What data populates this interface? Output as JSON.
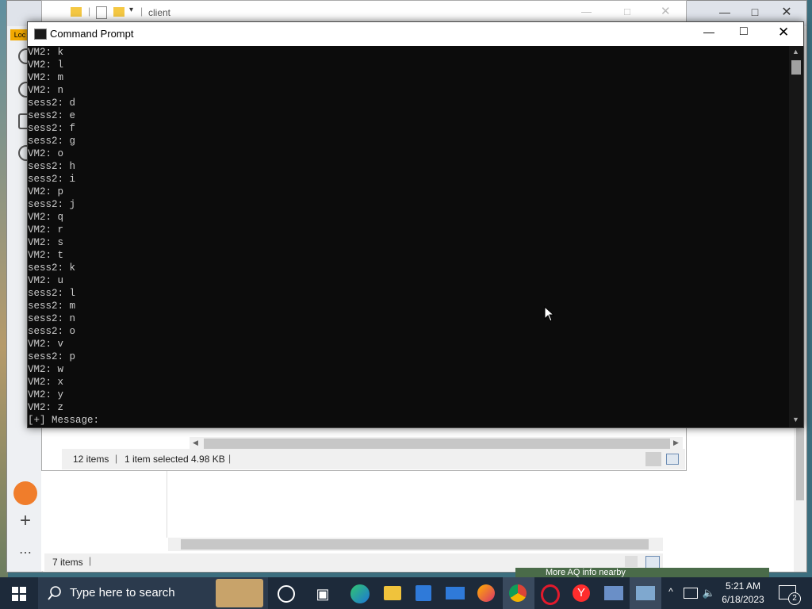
{
  "explorer_top": {
    "path_label": "client"
  },
  "explorer_front": {
    "item_count": "12 items",
    "selection": "1 item selected  4.98 KB"
  },
  "explorer_back": {
    "item_count": "7 items"
  },
  "browser": {
    "badge": "Loc",
    "bottom_text": "More AQ info nearby"
  },
  "cmd": {
    "title": "Command Prompt",
    "lines": [
      "VM2: k",
      "VM2: l",
      "VM2: m",
      "VM2: n",
      "sess2: d",
      "sess2: e",
      "sess2: f",
      "sess2: g",
      "VM2: o",
      "sess2: h",
      "sess2: i",
      "VM2: p",
      "sess2: j",
      "VM2: q",
      "VM2: r",
      "VM2: s",
      "VM2: t",
      "sess2: k",
      "VM2: u",
      "sess2: l",
      "sess2: m",
      "sess2: n",
      "sess2: o",
      "VM2: v",
      "sess2: p",
      "VM2: w",
      "VM2: x",
      "VM2: y",
      "VM2: z"
    ],
    "prompt": "[+] Message:"
  },
  "taskbar": {
    "search_placeholder": "Type here to search",
    "time": "5:21 AM",
    "date": "6/18/2023",
    "notification_count": "2"
  },
  "colors": {
    "cmd_bg": "#0c0c0c",
    "cmd_text": "#cccccc",
    "taskbar": "#1d2a3a"
  }
}
